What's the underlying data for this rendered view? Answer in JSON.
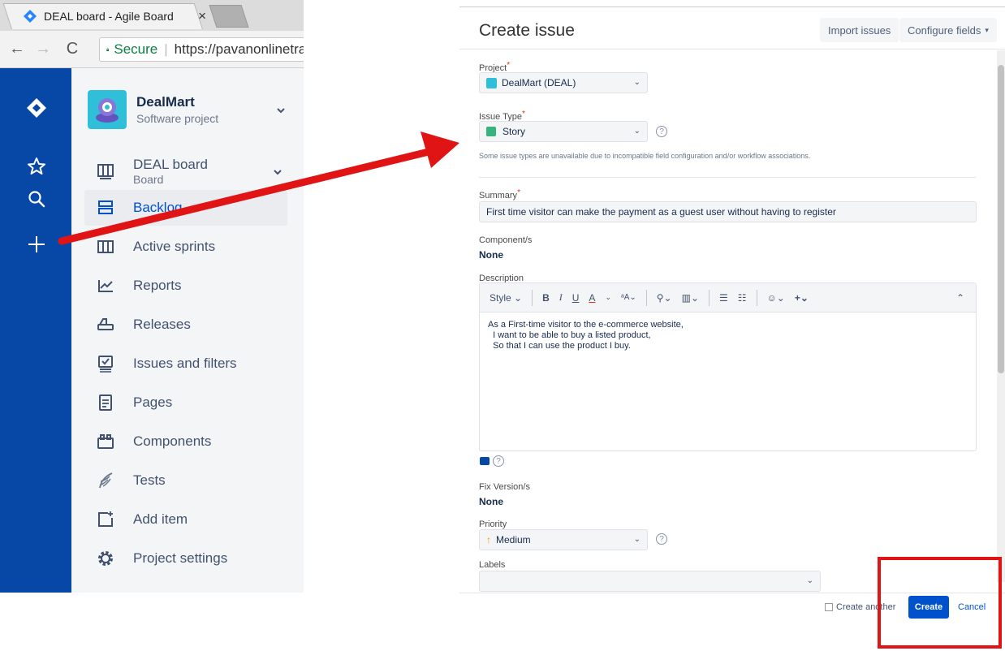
{
  "browser": {
    "tab_title": "DEAL board - Agile Board",
    "tab_close": "×",
    "secure_label": "Secure",
    "url": "https://pavanonlinetrai"
  },
  "global_nav": {
    "icons": [
      "jira-logo-icon",
      "star-icon",
      "search-icon",
      "plus-icon"
    ]
  },
  "project": {
    "name": "DealMart",
    "type": "Software project",
    "board_name": "DEAL board",
    "board_sub": "Board"
  },
  "nav_items": [
    {
      "label": "Backlog",
      "icon": "backlog-icon",
      "selected": true
    },
    {
      "label": "Active sprints",
      "icon": "active-sprints-icon"
    },
    {
      "label": "Reports",
      "icon": "reports-icon"
    },
    {
      "label": "Releases",
      "icon": "releases-icon"
    },
    {
      "label": "Issues and filters",
      "icon": "issues-filters-icon"
    },
    {
      "label": "Pages",
      "icon": "pages-icon"
    },
    {
      "label": "Components",
      "icon": "components-icon"
    },
    {
      "label": "Tests",
      "icon": "tests-icon"
    },
    {
      "label": "Add item",
      "icon": "add-item-icon"
    },
    {
      "label": "Project settings",
      "icon": "gear-icon"
    }
  ],
  "dialog": {
    "title": "Create issue",
    "import_label": "Import issues",
    "configure_label": "Configure fields",
    "project_label": "Project",
    "project_value": "DealMart (DEAL)",
    "issue_type_label": "Issue Type",
    "issue_type_value": "Story",
    "issue_type_note": "Some issue types are unavailable due to incompatible field configuration and/or workflow associations.",
    "summary_label": "Summary",
    "summary_value": "First time visitor can make the payment as a guest user without having to register",
    "component_label": "Component/s",
    "component_value": "None",
    "description_label": "Description",
    "toolbar_style": "Style",
    "description_lines": [
      "As a First-time visitor to the e-commerce website,",
      "  I want to be able to buy a listed product,",
      "  So that I can use the product I buy."
    ],
    "fix_version_label": "Fix Version/s",
    "fix_version_value": "None",
    "priority_label": "Priority",
    "priority_value": "Medium",
    "labels_label": "Labels",
    "create_another_label": "Create another",
    "create_label": "Create",
    "cancel_label": "Cancel"
  },
  "colors": {
    "global_nav": "#0747a6",
    "primary_button": "#0052cc",
    "annotation": "#e01414"
  }
}
